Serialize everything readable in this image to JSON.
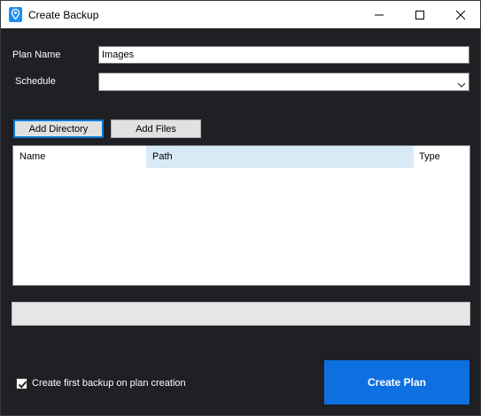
{
  "window": {
    "title": "Create Backup",
    "controls": {
      "minimize": "minimize-icon",
      "maximize": "maximize-icon",
      "close": "close-icon"
    }
  },
  "form": {
    "plan_name_label": "Plan Name",
    "plan_name_value": "Images",
    "schedule_label": "Schedule",
    "schedule_value": ""
  },
  "toolbar": {
    "add_directory_label": "Add Directory",
    "add_files_label": "Add Files"
  },
  "file_list": {
    "columns": [
      "Name",
      "Path",
      "Type"
    ],
    "rows": []
  },
  "progress": {
    "value_percent": 0
  },
  "options": {
    "first_backup_label": "Create first backup on plan creation",
    "first_backup_checked": true
  },
  "actions": {
    "create_plan_label": "Create Plan"
  },
  "colors": {
    "window_bg": "#1f2024",
    "accent": "#0e70e0",
    "selected_column": "#d9eaf7"
  }
}
